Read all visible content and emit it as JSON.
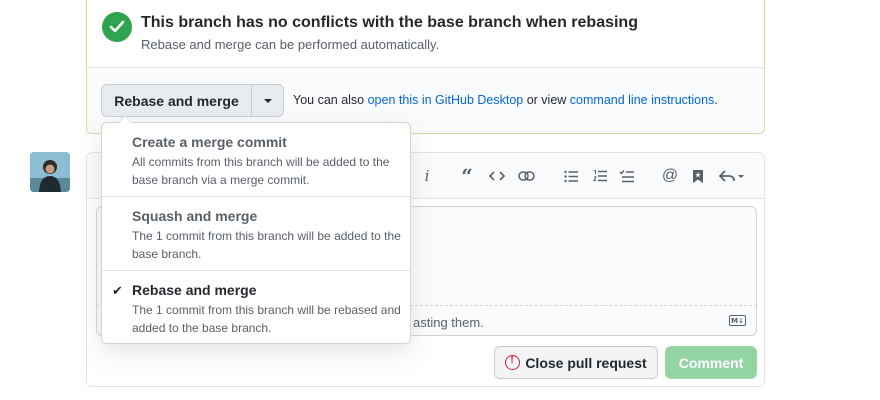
{
  "merge_status": {
    "title": "This branch has no conflicts with the base branch when rebasing",
    "subtitle": "Rebase and merge can be performed automatically.",
    "icon": "check-circle-icon",
    "color": "#2ea44f"
  },
  "merge_actions": {
    "button_label": "Rebase and merge",
    "alt_prefix": "You can also ",
    "desktop_link": "open this in GitHub Desktop",
    "alt_middle": " or view ",
    "cli_link": "command line instructions",
    "alt_suffix": "."
  },
  "dropdown": {
    "options": [
      {
        "title": "Create a merge commit",
        "description": "All commits from this branch will be added to the base branch via a merge commit.",
        "selected": false
      },
      {
        "title": "Squash and merge",
        "description": "The 1 commit from this branch will be added to the base branch.",
        "selected": false
      },
      {
        "title": "Rebase and merge",
        "description": "The 1 commit from this branch will be rebased and added to the base branch.",
        "selected": true
      }
    ],
    "check_glyph": "✔"
  },
  "comment": {
    "paste_text": "asting them.",
    "markdown_icon": "markdown-icon",
    "close_button": "Close pull request",
    "comment_button": "Comment",
    "toolbar_icons": [
      "italic-icon",
      "quote-icon",
      "code-icon",
      "link-icon",
      "unordered-list-icon",
      "ordered-list-icon",
      "task-list-icon",
      "mention-icon",
      "reference-icon",
      "reply-icon"
    ]
  }
}
